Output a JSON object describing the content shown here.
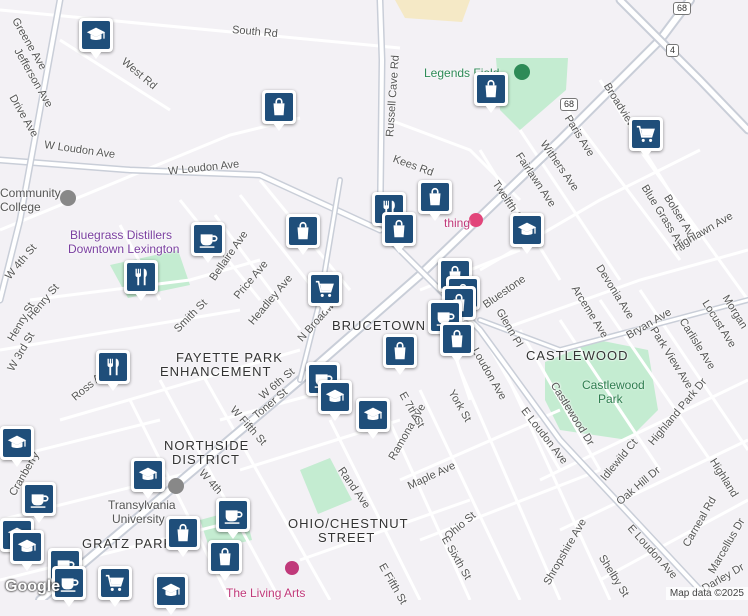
{
  "map": {
    "attribution": "Map data ©2025",
    "logo": "Google",
    "colors": {
      "background": "#f3f1f5",
      "road": "#ffffff",
      "major_road": "#c9ced8",
      "park": "#c4ecd1",
      "sand": "#f5e9c6",
      "marker": "#1f4e7a",
      "marker_border": "#ffffff"
    }
  },
  "streets": [
    "South Rd",
    "West Rd",
    "W Loudon Ave",
    "W Loudon Ave",
    "Russell Cave Rd",
    "Kees Rd",
    "Paris Ave",
    "Withers Ave",
    "Fairlawn Ave",
    "Twelfth St",
    "Broadview",
    "Bolser Ave",
    "Blue Grass Ave",
    "Highlawn Ave",
    "Bellaire Ave",
    "Price Ave",
    "Headley Ave",
    "N Broadway",
    "Smith St",
    "Henry St",
    "W 4th St",
    "W 3rd St",
    "Ross Ave",
    "W 6th St",
    "Toner St",
    "W Fifth St",
    "W 4th",
    "E 7th St",
    "Ramona Ave",
    "York St",
    "Maple Ave",
    "Rand Ave",
    "Ohio St",
    "E Sixth St",
    "E Fifth St",
    "Glenn Pl",
    "Bluestone",
    "Arceme Ave",
    "Devonia Ave",
    "Bryan Ave",
    "Park View Ave",
    "Carlisle Ave",
    "Locust Ave",
    "Morgan",
    "Castlewood Dr",
    "Highland Park Dr",
    "Idlewild Ct",
    "Oak Hill Dr",
    "E Loudon Ave",
    "Loudon Ave",
    "Highland",
    "Carneal Rd",
    "Marcellus Dr",
    "Darley Dr",
    "E Loudon Ave",
    "Shelby St",
    "Shropshire Ave",
    "Jefferson Ave",
    "Greene Ave",
    "Cranberry",
    "Drive Ave",
    "Henry St"
  ],
  "neighborhoods": [
    "BRUCETOWN",
    "CASTLEWOOD",
    "FAYETTE PARK",
    "ENHANCEMENT",
    "NORTHSIDE",
    "DISTRICT",
    "OHIO/CHESTNUT",
    "STREET",
    "GRATZ PARK"
  ],
  "pois": {
    "legends_field": "Legends Field",
    "community_college_1": "Community",
    "community_college_2": "College",
    "distillery_1": "Bluegrass Distillers",
    "distillery_2": "Downtown Lexington",
    "castlewood_park_1": "Castlewood",
    "castlewood_park_2": "Park",
    "transylvania_1": "Transylvania",
    "transylvania_2": "University",
    "living_arts": "The Living Arts",
    "thing": "thing"
  },
  "shields": [
    "68",
    "4",
    "68"
  ],
  "markers": [
    "graduation-cap",
    "shopping-bag",
    "shopping-bag",
    "shopping-cart",
    "restaurant",
    "shopping-bag",
    "shopping-bag",
    "graduation-cap",
    "shopping-bag",
    "coffee",
    "restaurant",
    "shopping-cart",
    "shopping-bag",
    "shopping-bag",
    "shopping-bag",
    "coffee",
    "shopping-bag",
    "shopping-bag",
    "restaurant",
    "coffee",
    "graduation-cap",
    "graduation-cap",
    "graduation-cap",
    "graduation-cap",
    "coffee",
    "graduation-cap",
    "coffee",
    "shopping-bag",
    "shopping-bag",
    "coffee",
    "shopping-cart",
    "coffee",
    "graduation-cap",
    "graduation-cap"
  ]
}
